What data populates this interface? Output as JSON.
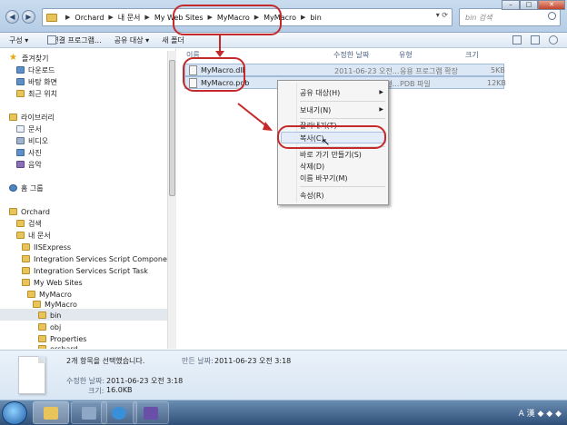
{
  "address": {
    "crumbs": [
      "Orchard",
      "내 문서",
      "My Web Sites",
      "MyMacro",
      "MyMacro",
      "bin"
    ]
  },
  "search": {
    "placeholder": "bin 검색"
  },
  "toolbar": {
    "organize": "구성 ▾",
    "open_with": "연결 프로그램...",
    "share": "공유 대상 ▾",
    "new_folder": "새 폴더"
  },
  "nav": {
    "favorites": "즐겨찾기",
    "downloads": "다운로드",
    "desktop": "바탕 화면",
    "recent": "최근 위치",
    "libraries": "라이브러리",
    "documents": "문서",
    "videos": "비디오",
    "pictures": "사진",
    "music": "음악",
    "homegroup": "홈 그룹",
    "orchard": "Orchard",
    "search": "검색",
    "my_docs": "내 문서",
    "iisexpress": "IISExpress",
    "ssis_component": "Integration Services Script Component",
    "ssis_task": "Integration Services Script Task",
    "my_web_sites": "My Web Sites",
    "mymacro1": "MyMacro",
    "mymacro2": "MyMacro",
    "bin": "bin",
    "obj": "obj",
    "properties": "Properties",
    "orchard_lower": "orchard"
  },
  "columns": {
    "name": "이름",
    "modified": "수정한 날짜",
    "type": "유형",
    "size": "크기"
  },
  "files": [
    {
      "name": "MyMacro.dll",
      "modified": "2011-06-23 오전...",
      "type": "응용 프로그램 확장",
      "size": "5KB"
    },
    {
      "name": "MyMacro.pdb",
      "modified": "2011-06-23 오전...",
      "type": "PDB 파일",
      "size": "12KB"
    }
  ],
  "context_menu": {
    "share": "공유 대상(H)",
    "send_to": "보내기(N)",
    "cut": "잘라내기(T)",
    "copy": "복사(C)",
    "shortcut": "바로 가기 만들기(S)",
    "delete": "삭제(D)",
    "rename": "이름 바꾸기(M)",
    "properties": "속성(R)"
  },
  "details": {
    "selected": "2개 항목을 선택했습니다.",
    "created_label": "만든 날짜:",
    "created_value": "2011-06-23 오전 3:18",
    "modified_label": "수정한 날짜:",
    "modified_value": "2011-06-23 오전 3:18",
    "size_label": "크기:",
    "size_value": "16.0KB"
  },
  "tray": {
    "text": "A 漢 ◆ ◆ ◆"
  },
  "colors": {
    "annotation": "#c42a2a",
    "selection": "#dbe7f4"
  }
}
